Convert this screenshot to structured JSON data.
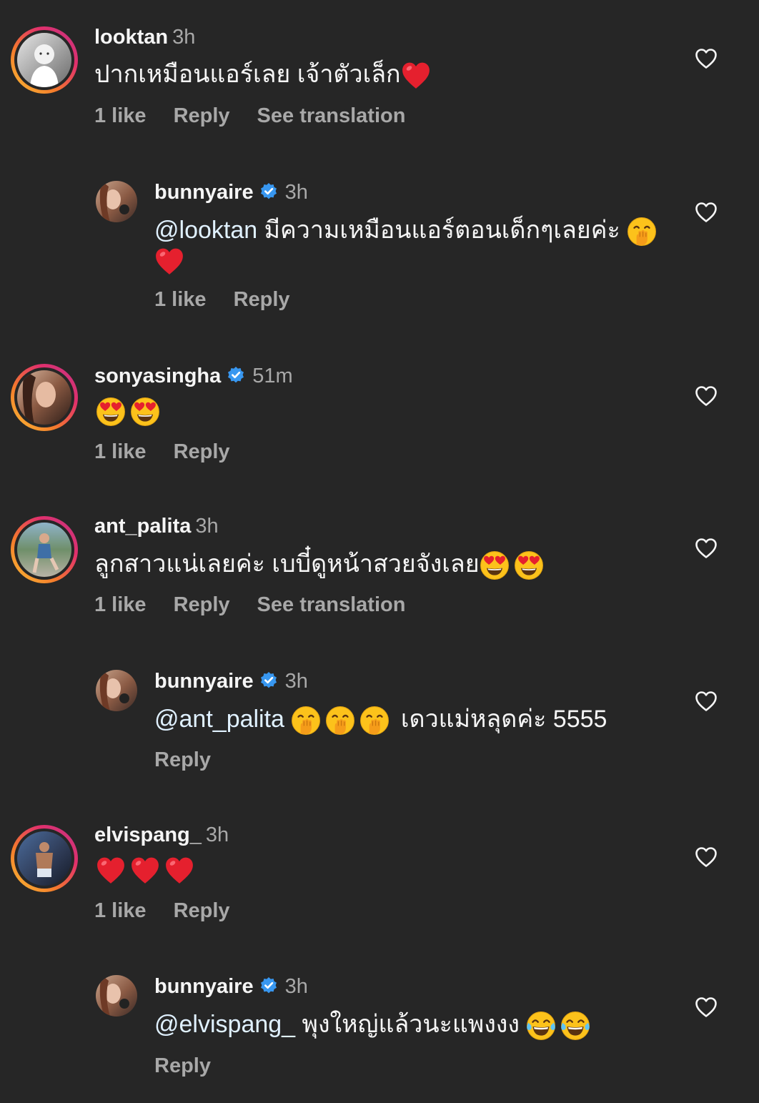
{
  "comments": [
    {
      "username": "looktan",
      "time": "3h",
      "text": "ปากเหมือนแอร์เลย เจ้าตัวเล็ก",
      "emoji": [
        "red-heart"
      ],
      "likes": "1 like",
      "reply": "Reply",
      "translate": "See translation"
    },
    {
      "username": "bunnyaire",
      "time": "3h",
      "mention": "@looktan",
      "text": "มีความเหมือนแอร์ตอนเด็กๆเลยค่ะ",
      "emoji": [
        "hand-over-mouth",
        "red-heart"
      ],
      "likes": "1 like",
      "reply": "Reply"
    },
    {
      "username": "sonyasingha",
      "time": "51m",
      "emoji": [
        "heart-eyes",
        "heart-eyes"
      ],
      "likes": "1 like",
      "reply": "Reply"
    },
    {
      "username": "ant_palita",
      "time": "3h",
      "text": "ลูกสาวแน่เลยค่ะ เบบี๋ดูหน้าสวยจังเลย",
      "emoji": [
        "heart-eyes",
        "heart-eyes"
      ],
      "likes": "1 like",
      "reply": "Reply",
      "translate": "See translation"
    },
    {
      "username": "bunnyaire",
      "time": "3h",
      "mention": "@ant_palita",
      "text": "เดวแม่หลุดค่ะ 5555",
      "emoji": [
        "hand-over-mouth",
        "hand-over-mouth",
        "hand-over-mouth"
      ],
      "reply": "Reply"
    },
    {
      "username": "elvispang_",
      "time": "3h",
      "emoji": [
        "red-heart",
        "red-heart",
        "red-heart"
      ],
      "likes": "1 like",
      "reply": "Reply"
    },
    {
      "username": "bunnyaire",
      "time": "3h",
      "mention": "@elvispang_",
      "text": "พุงใหญ่แล้วนะแพงงง",
      "emoji": [
        "tears-of-joy",
        "tears-of-joy"
      ],
      "reply": "Reply"
    }
  ],
  "colors": {
    "background": "#262626",
    "primary_text": "#f5f5f5",
    "secondary_text": "#a8a8a8",
    "mention": "#e0f1ff",
    "verified_badge": "#3897f0",
    "story_ring": [
      "#f9c035",
      "#e1306c",
      "#c13584"
    ]
  },
  "icons": [
    "heart-outline-icon",
    "verified-badge-icon",
    "red-heart-emoji",
    "heart-eyes-emoji",
    "hand-over-mouth-emoji",
    "tears-of-joy-emoji"
  ]
}
